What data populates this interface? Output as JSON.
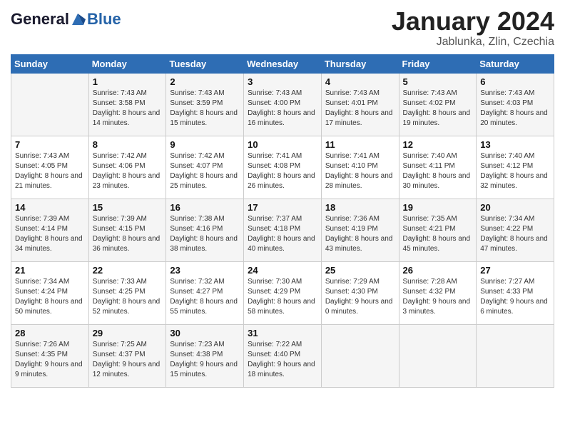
{
  "header": {
    "logo_line1": "General",
    "logo_line2": "Blue",
    "month": "January 2024",
    "location": "Jablunka, Zlin, Czechia"
  },
  "days_of_week": [
    "Sunday",
    "Monday",
    "Tuesday",
    "Wednesday",
    "Thursday",
    "Friday",
    "Saturday"
  ],
  "weeks": [
    [
      {
        "day": "",
        "sunrise": "",
        "sunset": "",
        "daylight": ""
      },
      {
        "day": "1",
        "sunrise": "Sunrise: 7:43 AM",
        "sunset": "Sunset: 3:58 PM",
        "daylight": "Daylight: 8 hours and 14 minutes."
      },
      {
        "day": "2",
        "sunrise": "Sunrise: 7:43 AM",
        "sunset": "Sunset: 3:59 PM",
        "daylight": "Daylight: 8 hours and 15 minutes."
      },
      {
        "day": "3",
        "sunrise": "Sunrise: 7:43 AM",
        "sunset": "Sunset: 4:00 PM",
        "daylight": "Daylight: 8 hours and 16 minutes."
      },
      {
        "day": "4",
        "sunrise": "Sunrise: 7:43 AM",
        "sunset": "Sunset: 4:01 PM",
        "daylight": "Daylight: 8 hours and 17 minutes."
      },
      {
        "day": "5",
        "sunrise": "Sunrise: 7:43 AM",
        "sunset": "Sunset: 4:02 PM",
        "daylight": "Daylight: 8 hours and 19 minutes."
      },
      {
        "day": "6",
        "sunrise": "Sunrise: 7:43 AM",
        "sunset": "Sunset: 4:03 PM",
        "daylight": "Daylight: 8 hours and 20 minutes."
      }
    ],
    [
      {
        "day": "7",
        "sunrise": "Sunrise: 7:43 AM",
        "sunset": "Sunset: 4:05 PM",
        "daylight": "Daylight: 8 hours and 21 minutes."
      },
      {
        "day": "8",
        "sunrise": "Sunrise: 7:42 AM",
        "sunset": "Sunset: 4:06 PM",
        "daylight": "Daylight: 8 hours and 23 minutes."
      },
      {
        "day": "9",
        "sunrise": "Sunrise: 7:42 AM",
        "sunset": "Sunset: 4:07 PM",
        "daylight": "Daylight: 8 hours and 25 minutes."
      },
      {
        "day": "10",
        "sunrise": "Sunrise: 7:41 AM",
        "sunset": "Sunset: 4:08 PM",
        "daylight": "Daylight: 8 hours and 26 minutes."
      },
      {
        "day": "11",
        "sunrise": "Sunrise: 7:41 AM",
        "sunset": "Sunset: 4:10 PM",
        "daylight": "Daylight: 8 hours and 28 minutes."
      },
      {
        "day": "12",
        "sunrise": "Sunrise: 7:40 AM",
        "sunset": "Sunset: 4:11 PM",
        "daylight": "Daylight: 8 hours and 30 minutes."
      },
      {
        "day": "13",
        "sunrise": "Sunrise: 7:40 AM",
        "sunset": "Sunset: 4:12 PM",
        "daylight": "Daylight: 8 hours and 32 minutes."
      }
    ],
    [
      {
        "day": "14",
        "sunrise": "Sunrise: 7:39 AM",
        "sunset": "Sunset: 4:14 PM",
        "daylight": "Daylight: 8 hours and 34 minutes."
      },
      {
        "day": "15",
        "sunrise": "Sunrise: 7:39 AM",
        "sunset": "Sunset: 4:15 PM",
        "daylight": "Daylight: 8 hours and 36 minutes."
      },
      {
        "day": "16",
        "sunrise": "Sunrise: 7:38 AM",
        "sunset": "Sunset: 4:16 PM",
        "daylight": "Daylight: 8 hours and 38 minutes."
      },
      {
        "day": "17",
        "sunrise": "Sunrise: 7:37 AM",
        "sunset": "Sunset: 4:18 PM",
        "daylight": "Daylight: 8 hours and 40 minutes."
      },
      {
        "day": "18",
        "sunrise": "Sunrise: 7:36 AM",
        "sunset": "Sunset: 4:19 PM",
        "daylight": "Daylight: 8 hours and 43 minutes."
      },
      {
        "day": "19",
        "sunrise": "Sunrise: 7:35 AM",
        "sunset": "Sunset: 4:21 PM",
        "daylight": "Daylight: 8 hours and 45 minutes."
      },
      {
        "day": "20",
        "sunrise": "Sunrise: 7:34 AM",
        "sunset": "Sunset: 4:22 PM",
        "daylight": "Daylight: 8 hours and 47 minutes."
      }
    ],
    [
      {
        "day": "21",
        "sunrise": "Sunrise: 7:34 AM",
        "sunset": "Sunset: 4:24 PM",
        "daylight": "Daylight: 8 hours and 50 minutes."
      },
      {
        "day": "22",
        "sunrise": "Sunrise: 7:33 AM",
        "sunset": "Sunset: 4:25 PM",
        "daylight": "Daylight: 8 hours and 52 minutes."
      },
      {
        "day": "23",
        "sunrise": "Sunrise: 7:32 AM",
        "sunset": "Sunset: 4:27 PM",
        "daylight": "Daylight: 8 hours and 55 minutes."
      },
      {
        "day": "24",
        "sunrise": "Sunrise: 7:30 AM",
        "sunset": "Sunset: 4:29 PM",
        "daylight": "Daylight: 8 hours and 58 minutes."
      },
      {
        "day": "25",
        "sunrise": "Sunrise: 7:29 AM",
        "sunset": "Sunset: 4:30 PM",
        "daylight": "Daylight: 9 hours and 0 minutes."
      },
      {
        "day": "26",
        "sunrise": "Sunrise: 7:28 AM",
        "sunset": "Sunset: 4:32 PM",
        "daylight": "Daylight: 9 hours and 3 minutes."
      },
      {
        "day": "27",
        "sunrise": "Sunrise: 7:27 AM",
        "sunset": "Sunset: 4:33 PM",
        "daylight": "Daylight: 9 hours and 6 minutes."
      }
    ],
    [
      {
        "day": "28",
        "sunrise": "Sunrise: 7:26 AM",
        "sunset": "Sunset: 4:35 PM",
        "daylight": "Daylight: 9 hours and 9 minutes."
      },
      {
        "day": "29",
        "sunrise": "Sunrise: 7:25 AM",
        "sunset": "Sunset: 4:37 PM",
        "daylight": "Daylight: 9 hours and 12 minutes."
      },
      {
        "day": "30",
        "sunrise": "Sunrise: 7:23 AM",
        "sunset": "Sunset: 4:38 PM",
        "daylight": "Daylight: 9 hours and 15 minutes."
      },
      {
        "day": "31",
        "sunrise": "Sunrise: 7:22 AM",
        "sunset": "Sunset: 4:40 PM",
        "daylight": "Daylight: 9 hours and 18 minutes."
      },
      {
        "day": "",
        "sunrise": "",
        "sunset": "",
        "daylight": ""
      },
      {
        "day": "",
        "sunrise": "",
        "sunset": "",
        "daylight": ""
      },
      {
        "day": "",
        "sunrise": "",
        "sunset": "",
        "daylight": ""
      }
    ]
  ]
}
